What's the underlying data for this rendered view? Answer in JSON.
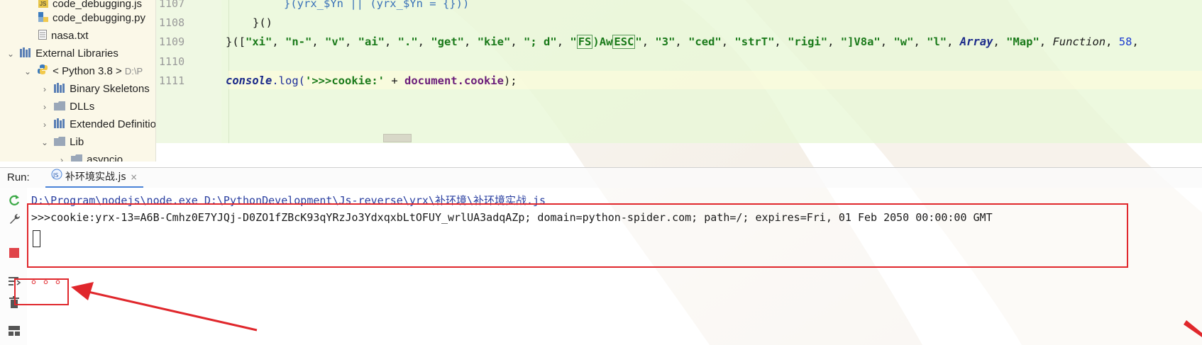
{
  "project_tree": {
    "rows": [
      {
        "label": "code_debugging.js"
      },
      {
        "label": "code_debugging.py"
      },
      {
        "label": "nasa.txt"
      },
      {
        "label": "External Libraries"
      },
      {
        "label": "< Python 3.8 >",
        "suffix": "D:\\P"
      },
      {
        "label": "Binary Skeletons"
      },
      {
        "label": "DLLs"
      },
      {
        "label": "Extended Definitions"
      },
      {
        "label": "Lib"
      },
      {
        "label": "asyncio"
      }
    ]
  },
  "editor": {
    "line_numbers": [
      "1107",
      "1108",
      "1109",
      "1110",
      "1111"
    ],
    "line_1107": "}(yrx_$Yn || (yrx_$Yn = {}))",
    "line_1108": "}()",
    "line_1109": {
      "prefix": "}([",
      "strings": [
        "\"xi\"",
        "\"n-\"",
        "\"v\"",
        "\"ai\"",
        "\".\"",
        "\"get\"",
        "\"kie\"",
        "\"; d\""
      ],
      "esc_prefix": "\"",
      "esc1": "FS",
      "esc_mid": ")Aw",
      "esc2": "ESC",
      "esc_suffix": "\"",
      "strings2": [
        "\"3\"",
        "\"ced\"",
        "\"strT\"",
        "\"rigi\"",
        "\"]V8a\"",
        "\"w\"",
        "\"l\""
      ],
      "array_kw": "Array",
      "map_str": "\"Map\"",
      "function_kw": "Function",
      "number": "58"
    },
    "line_1111": {
      "console": "console",
      "log": ".log(",
      "literal": "'>>>cookie:'",
      "plus": " + ",
      "document": "document",
      "cookie": ".cookie",
      "end": ");"
    }
  },
  "run": {
    "title": "Run:",
    "tab_label": "补环境实战.js",
    "tab_close": "×",
    "command": "D:\\Program\\nodejs\\node.exe D:\\PythonDevelopment\\Js-reverse\\yrx\\补环境\\补环境实战.js",
    "output": ">>>cookie:yrx-13=A6B-Cmhz0E7YJQj-D0ZO1fZBcK93qYRzJo3YdxqxbLtOFUY_wrlUA3adqAZp; domain=python-spider.com; path=/; expires=Fri, 01 Feb 2050 00:00:00 GMT",
    "dots": "。。。"
  },
  "colors": {
    "highlight": "#e0272c",
    "editor_bg": "#e8f7d6",
    "tree_bg": "#fbf8e8"
  }
}
